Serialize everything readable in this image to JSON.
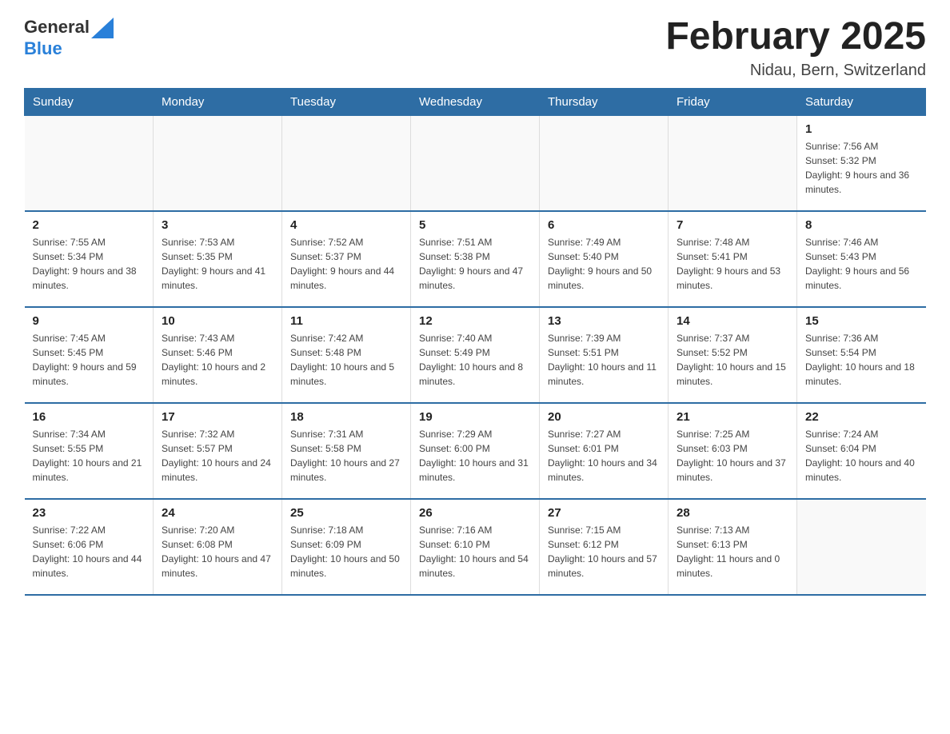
{
  "header": {
    "logo_general": "General",
    "logo_blue": "Blue",
    "month_title": "February 2025",
    "location": "Nidau, Bern, Switzerland"
  },
  "weekdays": [
    "Sunday",
    "Monday",
    "Tuesday",
    "Wednesday",
    "Thursday",
    "Friday",
    "Saturday"
  ],
  "weeks": [
    [
      {
        "day": "",
        "info": ""
      },
      {
        "day": "",
        "info": ""
      },
      {
        "day": "",
        "info": ""
      },
      {
        "day": "",
        "info": ""
      },
      {
        "day": "",
        "info": ""
      },
      {
        "day": "",
        "info": ""
      },
      {
        "day": "1",
        "info": "Sunrise: 7:56 AM\nSunset: 5:32 PM\nDaylight: 9 hours and 36 minutes."
      }
    ],
    [
      {
        "day": "2",
        "info": "Sunrise: 7:55 AM\nSunset: 5:34 PM\nDaylight: 9 hours and 38 minutes."
      },
      {
        "day": "3",
        "info": "Sunrise: 7:53 AM\nSunset: 5:35 PM\nDaylight: 9 hours and 41 minutes."
      },
      {
        "day": "4",
        "info": "Sunrise: 7:52 AM\nSunset: 5:37 PM\nDaylight: 9 hours and 44 minutes."
      },
      {
        "day": "5",
        "info": "Sunrise: 7:51 AM\nSunset: 5:38 PM\nDaylight: 9 hours and 47 minutes."
      },
      {
        "day": "6",
        "info": "Sunrise: 7:49 AM\nSunset: 5:40 PM\nDaylight: 9 hours and 50 minutes."
      },
      {
        "day": "7",
        "info": "Sunrise: 7:48 AM\nSunset: 5:41 PM\nDaylight: 9 hours and 53 minutes."
      },
      {
        "day": "8",
        "info": "Sunrise: 7:46 AM\nSunset: 5:43 PM\nDaylight: 9 hours and 56 minutes."
      }
    ],
    [
      {
        "day": "9",
        "info": "Sunrise: 7:45 AM\nSunset: 5:45 PM\nDaylight: 9 hours and 59 minutes."
      },
      {
        "day": "10",
        "info": "Sunrise: 7:43 AM\nSunset: 5:46 PM\nDaylight: 10 hours and 2 minutes."
      },
      {
        "day": "11",
        "info": "Sunrise: 7:42 AM\nSunset: 5:48 PM\nDaylight: 10 hours and 5 minutes."
      },
      {
        "day": "12",
        "info": "Sunrise: 7:40 AM\nSunset: 5:49 PM\nDaylight: 10 hours and 8 minutes."
      },
      {
        "day": "13",
        "info": "Sunrise: 7:39 AM\nSunset: 5:51 PM\nDaylight: 10 hours and 11 minutes."
      },
      {
        "day": "14",
        "info": "Sunrise: 7:37 AM\nSunset: 5:52 PM\nDaylight: 10 hours and 15 minutes."
      },
      {
        "day": "15",
        "info": "Sunrise: 7:36 AM\nSunset: 5:54 PM\nDaylight: 10 hours and 18 minutes."
      }
    ],
    [
      {
        "day": "16",
        "info": "Sunrise: 7:34 AM\nSunset: 5:55 PM\nDaylight: 10 hours and 21 minutes."
      },
      {
        "day": "17",
        "info": "Sunrise: 7:32 AM\nSunset: 5:57 PM\nDaylight: 10 hours and 24 minutes."
      },
      {
        "day": "18",
        "info": "Sunrise: 7:31 AM\nSunset: 5:58 PM\nDaylight: 10 hours and 27 minutes."
      },
      {
        "day": "19",
        "info": "Sunrise: 7:29 AM\nSunset: 6:00 PM\nDaylight: 10 hours and 31 minutes."
      },
      {
        "day": "20",
        "info": "Sunrise: 7:27 AM\nSunset: 6:01 PM\nDaylight: 10 hours and 34 minutes."
      },
      {
        "day": "21",
        "info": "Sunrise: 7:25 AM\nSunset: 6:03 PM\nDaylight: 10 hours and 37 minutes."
      },
      {
        "day": "22",
        "info": "Sunrise: 7:24 AM\nSunset: 6:04 PM\nDaylight: 10 hours and 40 minutes."
      }
    ],
    [
      {
        "day": "23",
        "info": "Sunrise: 7:22 AM\nSunset: 6:06 PM\nDaylight: 10 hours and 44 minutes."
      },
      {
        "day": "24",
        "info": "Sunrise: 7:20 AM\nSunset: 6:08 PM\nDaylight: 10 hours and 47 minutes."
      },
      {
        "day": "25",
        "info": "Sunrise: 7:18 AM\nSunset: 6:09 PM\nDaylight: 10 hours and 50 minutes."
      },
      {
        "day": "26",
        "info": "Sunrise: 7:16 AM\nSunset: 6:10 PM\nDaylight: 10 hours and 54 minutes."
      },
      {
        "day": "27",
        "info": "Sunrise: 7:15 AM\nSunset: 6:12 PM\nDaylight: 10 hours and 57 minutes."
      },
      {
        "day": "28",
        "info": "Sunrise: 7:13 AM\nSunset: 6:13 PM\nDaylight: 11 hours and 0 minutes."
      },
      {
        "day": "",
        "info": ""
      }
    ]
  ]
}
